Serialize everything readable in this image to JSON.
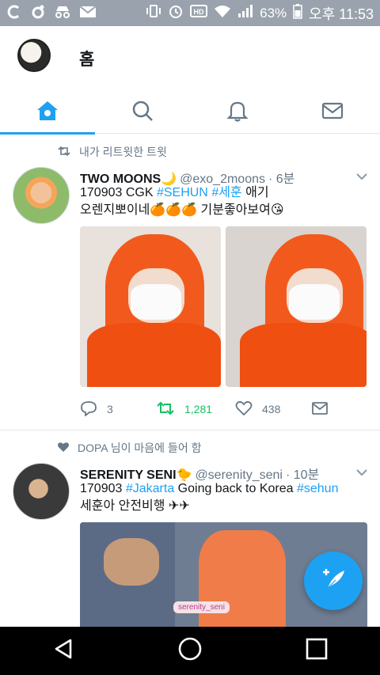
{
  "status_bar": {
    "battery": "63%",
    "time": "오후 11:53",
    "icons": [
      "circle-c-icon",
      "circle-o-icon",
      "incognito-icon",
      "mail-icon",
      "vibrate-icon",
      "alarm-icon",
      "hd-icon",
      "wifi-icon",
      "signal-icon",
      "battery-icon"
    ]
  },
  "header": {
    "title": "홈",
    "tabs": [
      {
        "icon": "home-icon",
        "active": true
      },
      {
        "icon": "search-icon",
        "active": false
      },
      {
        "icon": "bell-icon",
        "active": false
      },
      {
        "icon": "mail-icon",
        "active": false
      }
    ]
  },
  "colors": {
    "accent": "#1da1f2",
    "retweet": "#17bf63",
    "secondary": "#657786"
  },
  "tweets": [
    {
      "context": "내가 리트윗한 트윗",
      "context_icon": "retweet-icon",
      "name": "TWO MOONS🌙",
      "handle": "@exo_2moons",
      "time": "· 6분",
      "text_parts": [
        "170903 CGK ",
        "#SEHUN",
        " ",
        "#세훈",
        " 애기"
      ],
      "text_line2": "오렌지뽀이네🍊🍊🍊 기분좋아보여😘",
      "actions": {
        "replies": "3",
        "retweets": "1,281",
        "likes": "438"
      }
    },
    {
      "context": "DOPA 님이 마음에 들어 함",
      "context_icon": "heart-icon",
      "name": "SERENITY SENI🐤",
      "handle": "@serenity_seni",
      "time": "· 10분",
      "text_parts": [
        "170903 ",
        "#Jakarta",
        "  Going back to Korea ",
        "#sehun"
      ],
      "text_line2": "세훈아 안전비행 ✈✈",
      "photo_watermark": "serenity_seni"
    }
  ]
}
